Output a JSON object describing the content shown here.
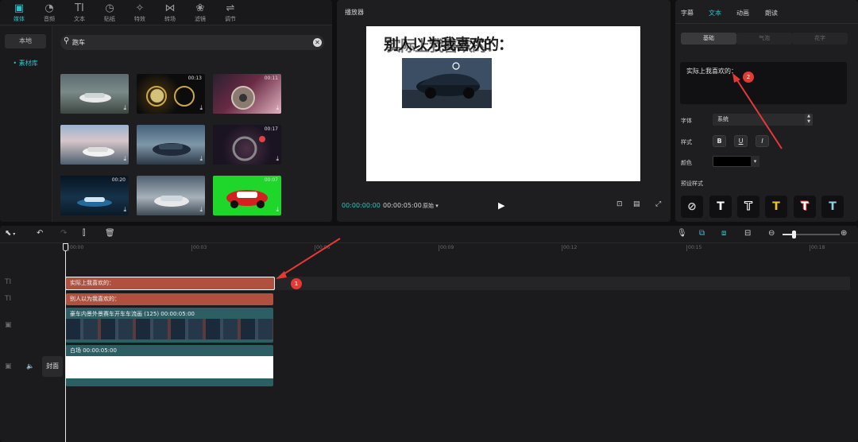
{
  "media": {
    "tabs": [
      {
        "label": "媒体",
        "icon": "media-icon"
      },
      {
        "label": "音频",
        "icon": "audio-icon"
      },
      {
        "label": "文本",
        "icon": "text-icon"
      },
      {
        "label": "贴纸",
        "icon": "sticker-icon"
      },
      {
        "label": "特效",
        "icon": "effects-icon"
      },
      {
        "label": "转场",
        "icon": "transition-icon"
      },
      {
        "label": "滤镜",
        "icon": "filter-icon"
      },
      {
        "label": "调节",
        "icon": "adjust-icon"
      }
    ],
    "side_items": [
      "本地",
      "• 素材库"
    ],
    "search_value": "跑车",
    "thumbnails": [
      {
        "duration": ""
      },
      {
        "duration": "00:13"
      },
      {
        "duration": "00:11"
      },
      {
        "duration": ""
      },
      {
        "duration": ""
      },
      {
        "duration": "00:17"
      },
      {
        "duration": "00:20"
      },
      {
        "duration": ""
      },
      {
        "duration": "00:07"
      }
    ]
  },
  "player": {
    "title": "播放器",
    "canvas_text": "别人以为我喜欢的：",
    "time_current": "00:00:00:00",
    "time_total": "00:00:05:00",
    "ratio_label": "原始"
  },
  "props": {
    "tabs": [
      "字幕",
      "文本",
      "动画",
      "朗读"
    ],
    "segments": [
      "基础",
      "气泡",
      "花字"
    ],
    "text_value": "实际上我喜欢的：",
    "font_label": "字体",
    "font_value": "系统",
    "style_label": "样式",
    "style_buttons": [
      "B",
      "U",
      "I"
    ],
    "color_label": "颜色",
    "color_value": "#000000",
    "preset_label": "预设样式"
  },
  "timeline": {
    "ticks": [
      "00:00",
      "00:03",
      "00:06",
      "00:09",
      "00:12",
      "00:15",
      "00:18"
    ],
    "text_clip_1": "实际上我喜欢的：",
    "text_clip_2": "别人以为我喜欢的：",
    "video_clip": "豪车内景外景赛车开车车流画 (125)   00:00:05:00",
    "white_clip": "白场   00:00:05:00",
    "cover_label": "封面"
  },
  "annotations": {
    "marker_1": "1",
    "marker_2": "2",
    "accent_color": "#e53935"
  }
}
